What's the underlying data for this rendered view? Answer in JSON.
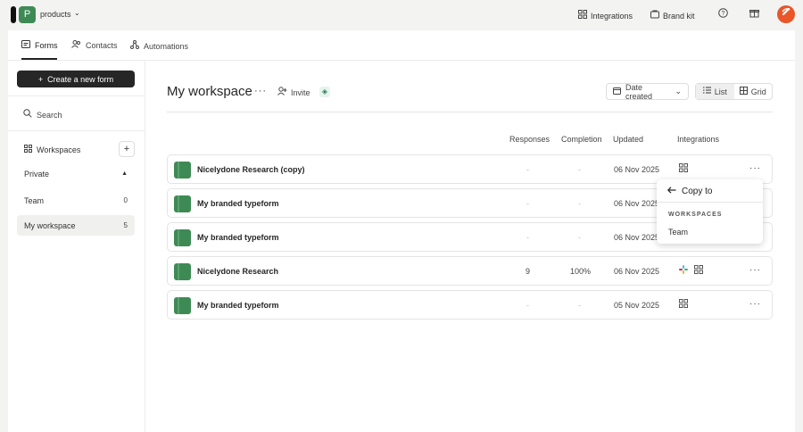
{
  "topbar": {
    "workspace_initial": "P",
    "workspace_name": "products",
    "integrations_label": "Integrations",
    "brand_kit_label": "Brand kit",
    "avatar_color": "#e8562a"
  },
  "tabs": [
    {
      "label": "Forms",
      "icon": "form-icon"
    },
    {
      "label": "Contacts",
      "icon": "people-icon"
    },
    {
      "label": "Automations",
      "icon": "automation-icon"
    }
  ],
  "sidebar": {
    "create_label": "Create a new form",
    "search_label": "Search",
    "workspaces_label": "Workspaces",
    "private_label": "Private",
    "items": [
      {
        "label": "Team",
        "count": "0"
      },
      {
        "label": "My workspace",
        "count": "5"
      }
    ]
  },
  "main": {
    "title": "My workspace",
    "invite_label": "Invite",
    "sort_label": "Date created",
    "view_list_label": "List",
    "view_grid_label": "Grid",
    "columns": {
      "responses": "Responses",
      "completion": "Completion",
      "updated": "Updated",
      "integrations": "Integrations"
    },
    "rows": [
      {
        "name": "Nicelydone Research (copy)",
        "responses": "-",
        "completion": "-",
        "updated": "06 Nov 2025"
      },
      {
        "name": "My branded typeform",
        "responses": "-",
        "completion": "-",
        "updated": "06 Nov 2025"
      },
      {
        "name": "My branded typeform",
        "responses": "-",
        "completion": "-",
        "updated": "06 Nov 2025"
      },
      {
        "name": "Nicelydone Research",
        "responses": "9",
        "completion": "100%",
        "updated": "06 Nov 2025"
      },
      {
        "name": "My branded typeform",
        "responses": "-",
        "completion": "-",
        "updated": "05 Nov 2025"
      }
    ]
  },
  "popup": {
    "title": "Copy to",
    "section": "WORKSPACES",
    "item": "Team"
  },
  "colors": {
    "accent_dark": "#262626",
    "form_thumb": "#3e8a55"
  }
}
